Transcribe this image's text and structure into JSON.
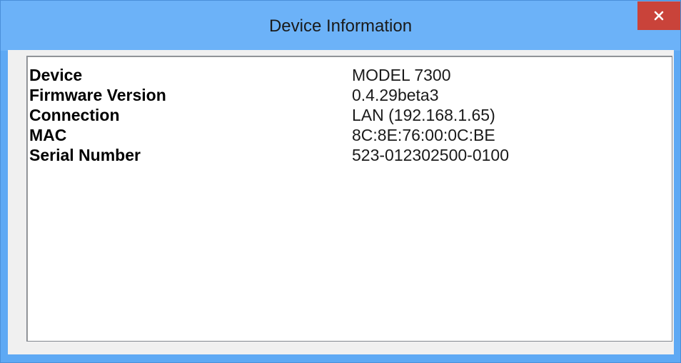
{
  "window": {
    "title": "Device Information",
    "close_icon": "close-icon"
  },
  "info": {
    "rows": [
      {
        "label": "Device",
        "value": "MODEL 7300"
      },
      {
        "label": "Firmware Version",
        "value": "0.4.29beta3"
      },
      {
        "label": "Connection",
        "value": "LAN (192.168.1.65)"
      },
      {
        "label": "MAC",
        "value": "8C:8E:76:00:0C:BE"
      },
      {
        "label": "Serial Number",
        "value": "523-012302500-0100"
      }
    ]
  },
  "colors": {
    "titlebar": "#6cb2f8",
    "close_button": "#c9433a",
    "client_bg": "#f0f0f0",
    "panel_bg": "#ffffff"
  }
}
